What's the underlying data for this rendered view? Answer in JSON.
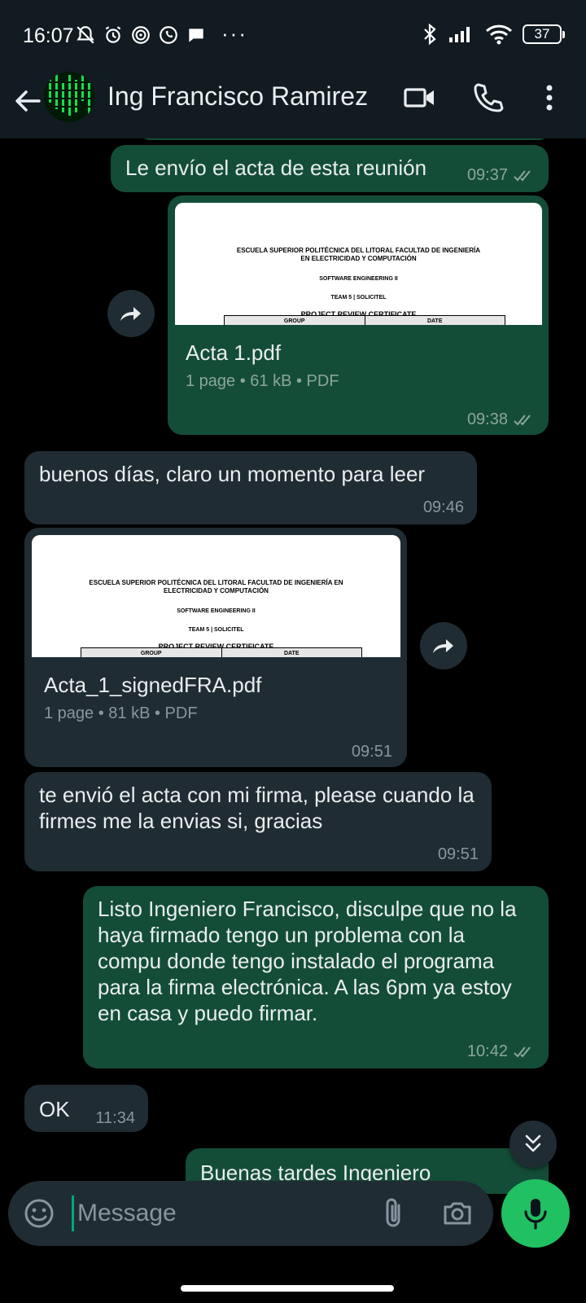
{
  "status_bar": {
    "time": "16:07",
    "dots": "···",
    "battery": "37"
  },
  "header": {
    "contact_name": "Ing Francisco Ramirez"
  },
  "messages": [
    {
      "type": "text",
      "dir": "out",
      "text": "Le envío el acta de esta reunión",
      "time": "09:37"
    },
    {
      "type": "document",
      "dir": "out",
      "file_name": "Acta 1.pdf",
      "meta": "1 page • 61 kB • PDF",
      "time": "09:38"
    },
    {
      "type": "text",
      "dir": "in",
      "text": "buenos días, claro un momento para leer",
      "time": "09:46"
    },
    {
      "type": "document",
      "dir": "in",
      "file_name": "Acta_1_signedFRA.pdf",
      "meta": "1 page • 81 kB • PDF",
      "time": "09:51"
    },
    {
      "type": "text",
      "dir": "in",
      "text": "te envió el acta con mi firma, please cuando la firmes me la envias si, gracias",
      "time": "09:51"
    },
    {
      "type": "text",
      "dir": "out",
      "text": "Listo Ingeniero Francisco, disculpe que no la haya firmado tengo un problema con la compu donde tengo instalado el programa para la firma electrónica. A las 6pm ya estoy en casa y puedo firmar.",
      "time": "10:42"
    },
    {
      "type": "text",
      "dir": "in",
      "text": "OK",
      "time": "11:34"
    },
    {
      "type": "text",
      "dir": "out",
      "text": "Buenas tardes Ingeniero",
      "time": ""
    }
  ],
  "doc_preview": {
    "institution": "ESCUELA SUPERIOR POLITÉCNICA DEL LITORAL FACULTAD DE INGENIERÍA EN ELECTRICIDAD Y COMPUTACIÓN",
    "course": "SOFTWARE ENGINEERING II",
    "team": "TEAM 5 | SOLICITEL",
    "title": "PROJECT REVIEW CERTIFICATE",
    "col_group": "GROUP",
    "col_date": "DATE"
  },
  "input": {
    "placeholder": "Message"
  },
  "colors": {
    "outgoing": "#144d37",
    "incoming": "#202c33",
    "accent": "#21c063",
    "header": "#111b21"
  }
}
